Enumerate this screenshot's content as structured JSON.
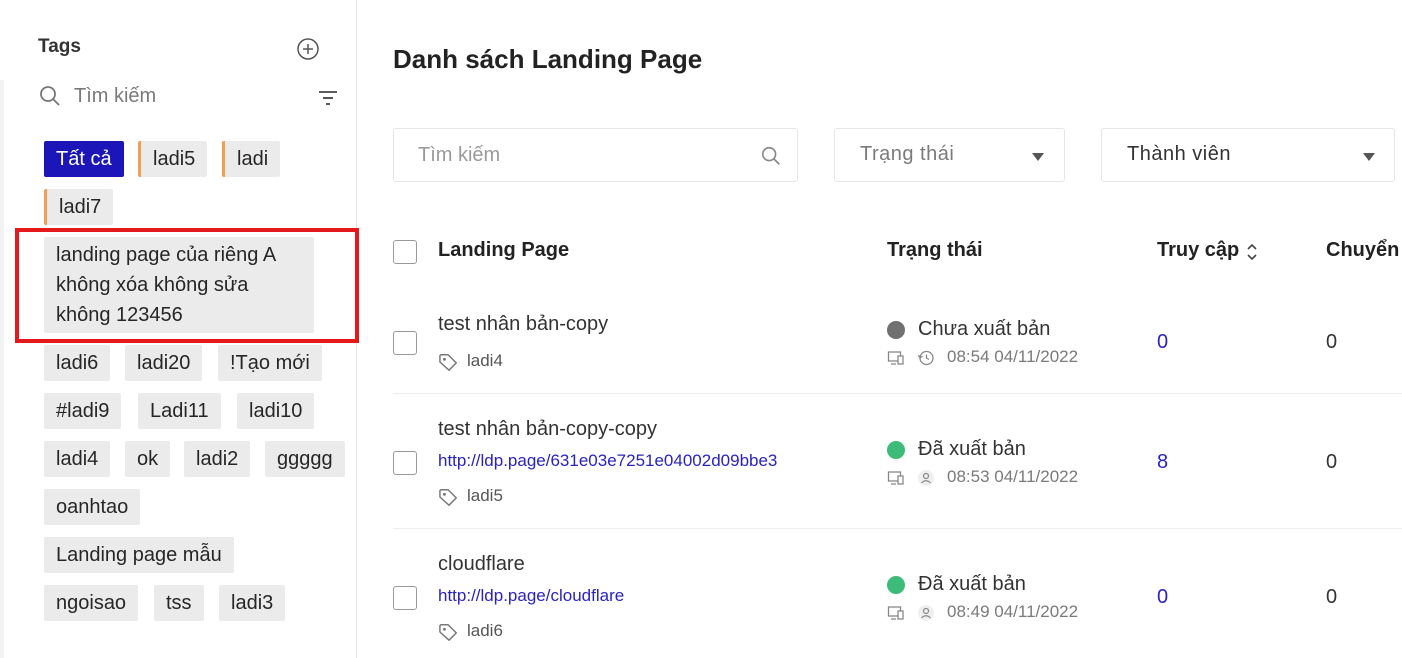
{
  "sidebar": {
    "title": "Tags",
    "search_placeholder": "Tìm kiếm",
    "tags": [
      {
        "label": "Tất cả",
        "active": true
      },
      {
        "label": "ladi5"
      },
      {
        "label": "ladi"
      },
      {
        "label": "ladi7"
      },
      {
        "label": "landing page của riêng A không xóa không sửa không 123456"
      },
      {
        "label": "ladi6"
      },
      {
        "label": "ladi20"
      },
      {
        "label": "!Tạo mới"
      },
      {
        "label": "#ladi9"
      },
      {
        "label": "Ladi11"
      },
      {
        "label": "ladi10"
      },
      {
        "label": "ladi4"
      },
      {
        "label": "ok"
      },
      {
        "label": "ladi2"
      },
      {
        "label": "ggggg"
      },
      {
        "label": "oanhtao"
      },
      {
        "label": "Landing page mẫu"
      },
      {
        "label": "ngoisao"
      },
      {
        "label": "tss"
      },
      {
        "label": "ladi3"
      }
    ]
  },
  "main": {
    "title": "Danh sách Landing Page",
    "search_placeholder": "Tìm kiếm",
    "filter_status": "Trạng thái",
    "filter_member": "Thành viên",
    "columns": [
      "Landing Page",
      "Trạng thái",
      "Truy cập",
      "Chuyển"
    ],
    "rows": [
      {
        "name": "test nhân bản-copy",
        "url": "",
        "tag": "ladi4",
        "status": "Chưa xuất bản",
        "status_color": "#707070",
        "time": "08:54 04/11/2022",
        "visits": "0",
        "conversions": "0"
      },
      {
        "name": "test nhân bản-copy-copy",
        "url": "http://ldp.page/631e03e7251e04002d09bbe3",
        "tag": "ladi5",
        "status": "Đã xuất bản",
        "status_color": "#3dbb78",
        "time": "08:53 04/11/2022",
        "visits": "8",
        "conversions": "0"
      },
      {
        "name": "cloudflare",
        "url": "http://ldp.page/cloudflare",
        "tag": "ladi6",
        "status": "Đã xuất bản",
        "status_color": "#3dbb78",
        "time": "08:49 04/11/2022",
        "visits": "0",
        "conversions": "0"
      }
    ]
  },
  "colors": {
    "active_tag": "#1c16b8",
    "tag_accent": "#f0a050",
    "highlight": "#e5191c",
    "link": "#2a22c0"
  },
  "icons": [
    "plus-circle-icon",
    "search-icon",
    "filter-icon",
    "chevron-down-icon",
    "sort-icon",
    "tag-icon",
    "device-icon",
    "history-icon",
    "user-icon"
  ]
}
